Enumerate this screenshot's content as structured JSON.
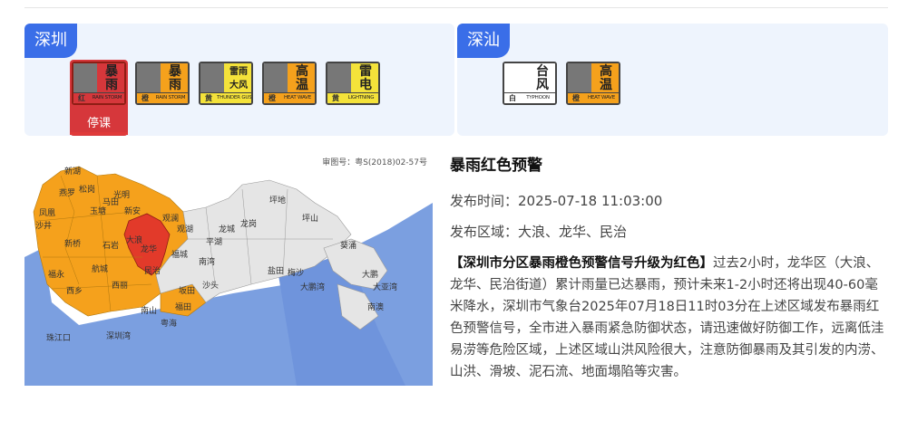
{
  "regions": [
    {
      "name": "深圳"
    },
    {
      "name": "深汕"
    }
  ],
  "shenzhen_icons": [
    {
      "big1": "暴",
      "big2": "雨",
      "level": "红",
      "en": "RAIN STORM",
      "color": "#d6373b",
      "icon": "rainstorm-red-icon"
    },
    {
      "big1": "暴",
      "big2": "雨",
      "level": "橙",
      "en": "RAIN STORM",
      "color": "#f5a11c",
      "icon": "rainstorm-orange-icon"
    },
    {
      "big1": "雷雨",
      "big2": "大风",
      "level": "黄",
      "en": "THUNDER GUST",
      "color": "#f4e23a",
      "icon": "thunder-gust-yellow-icon"
    },
    {
      "big1": "高",
      "big2": "温",
      "level": "橙",
      "en": "HEAT WAVE",
      "color": "#f5a11c",
      "icon": "heat-wave-orange-icon"
    },
    {
      "big1": "雷",
      "big2": "电",
      "level": "黄",
      "en": "LIGHTNING",
      "color": "#f4e23a",
      "icon": "lightning-yellow-icon"
    }
  ],
  "shenzhen_stop": "停课",
  "shenshan_icons": [
    {
      "big1": "台",
      "big2": "风",
      "level": "白",
      "en": "TYPHOON",
      "color": "#ffffff",
      "icon": "typhoon-white-icon"
    },
    {
      "big1": "高",
      "big2": "温",
      "level": "橙",
      "en": "HEAT WAVE",
      "color": "#f5a11c",
      "icon": "heat-wave-orange-icon"
    }
  ],
  "map": {
    "code": "审图号：粤S(2018)02-57号",
    "labels": [
      "新湖",
      "光明",
      "凤凰",
      "玉塘",
      "松岗",
      "燕罗",
      "马田",
      "新安",
      "石岩",
      "沙井",
      "新桥",
      "福永",
      "航城",
      "西乡",
      "西丽",
      "大浪",
      "龙华",
      "民治",
      "观澜",
      "观湖",
      "福城",
      "坂田",
      "南湾",
      "平湖",
      "龙城",
      "龙岗",
      "坪地",
      "坪山",
      "葵涌",
      "大鹏",
      "南澳",
      "大亚湾",
      "大鹏湾",
      "深圳湾",
      "珠江口",
      "盐田",
      "梅沙",
      "福田",
      "南山",
      "粤海",
      "沙头"
    ]
  },
  "warning": {
    "title": "暴雨红色预警",
    "time_label": "发布时间：",
    "time": "2025-07-18 11:03:00",
    "area_label": "发布区域：",
    "area": "大浪、龙华、民治",
    "headline": "【深圳市分区暴雨橙色预警信号升级为红色】",
    "text": "过去2小时，龙华区（大浪、龙华、民治街道）累计雨量已达暴雨，预计未来1-2小时还将出现40-60毫米降水，深圳市气象台2025年07月18日11时03分在上述区域发布暴雨红色预警信号，全市进入暴雨紧急防御状态，请迅速做好防御工作，远离低洼易涝等危险区域，上述区域山洪风险很大，注意防御暴雨及其引发的内涝、山洪、滑坡、泥石流、地面塌陷等灾害。"
  }
}
